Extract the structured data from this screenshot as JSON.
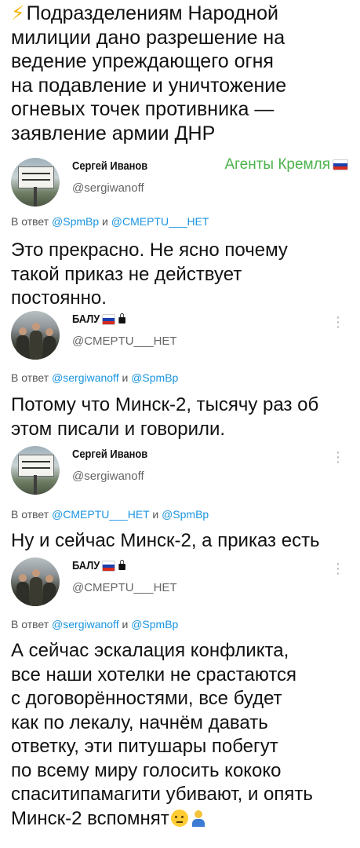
{
  "headline": {
    "icon": "lightning-icon",
    "lines": [
      "Подразделениям Народной",
      "милиции дано разрешение на",
      "ведение упреждающего огня",
      "на подавление и уничтожение",
      "огневых точек противника —",
      "заявление армии ДНР"
    ]
  },
  "tweets": [
    {
      "name": "Сергей Иванов",
      "handle": "@sergiwanoff",
      "badge": "Агенты Кремля",
      "reply_prefix": "В ответ",
      "reply_to": [
        "@SpmBp",
        "@CMEPTU___HET"
      ],
      "reply_joiner": "и",
      "text_lines": [
        "Это прекрасно. Не ясно почему",
        "такой приказ не действует",
        "постоянно."
      ]
    },
    {
      "name": "БАЛУ",
      "handle": "@CMEPTU___HET",
      "reply_prefix": "В ответ",
      "reply_to": [
        "@sergiwanoff",
        "@SpmBp"
      ],
      "reply_joiner": "и",
      "text_lines": [
        "Потому что Минск-2, тысячу раз об",
        "этом писали и говорили."
      ]
    },
    {
      "name": "Сергей Иванов",
      "handle": "@sergiwanoff",
      "reply_prefix": "В ответ",
      "reply_to": [
        "@CMEPTU___HET",
        "@SpmBp"
      ],
      "reply_joiner": "и",
      "text_lines": [
        "Ну и сейчас Минск-2, а приказ есть"
      ]
    },
    {
      "name": "БАЛУ",
      "handle": "@CMEPTU___HET",
      "reply_prefix": "В ответ",
      "reply_to": [
        "@sergiwanoff",
        "@SpmBp"
      ],
      "reply_joiner": "и",
      "text_lines": [
        "А сейчас эскалация конфликта,",
        "все наши хотелки не срастаются",
        "с договорённостями, все будет",
        "как по лекалу, начнём давать",
        "ответку, эти питушары побегут",
        "по всему миру голосить кококо",
        "спаситипамагити убивают, и опять",
        "Минск-2 вспомнят"
      ]
    }
  ],
  "icons": {
    "menu": "more-vertical-icon",
    "flag": "russia-flag-icon",
    "lock": "lock-icon",
    "emoji_1": "neutral-face-emoji",
    "emoji_2": "facepalm-person-emoji"
  },
  "colors": {
    "text": "#111111",
    "muted": "#666666",
    "mention": "#1b95e0",
    "badge": "#4cb34c",
    "bolt": "#f6b400"
  }
}
